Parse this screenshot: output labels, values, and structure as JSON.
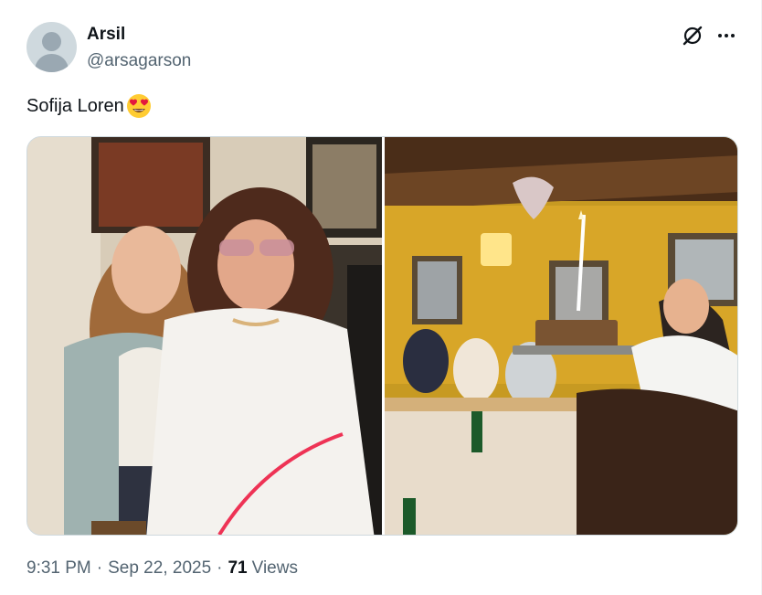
{
  "user": {
    "display_name": "Arsil",
    "handle": "@arsagarson"
  },
  "icons": {
    "grok": "grok-icon",
    "more": "more-icon",
    "emoji": "heart-eyes-emoji-icon",
    "avatar": "default-avatar-icon"
  },
  "tweet": {
    "text": "Sofija Loren"
  },
  "media": {
    "left_photo": "photo-two-women",
    "right_photo": "photo-birthday-cake-dinner"
  },
  "meta": {
    "time": "9:31 PM",
    "sep1": "·",
    "date": "Sep 22, 2025",
    "sep2": "·",
    "views_count": "71",
    "views_label": "Views"
  },
  "colors": {
    "text_primary": "#0f1419",
    "text_secondary": "#536471",
    "border": "#cfd9de"
  }
}
